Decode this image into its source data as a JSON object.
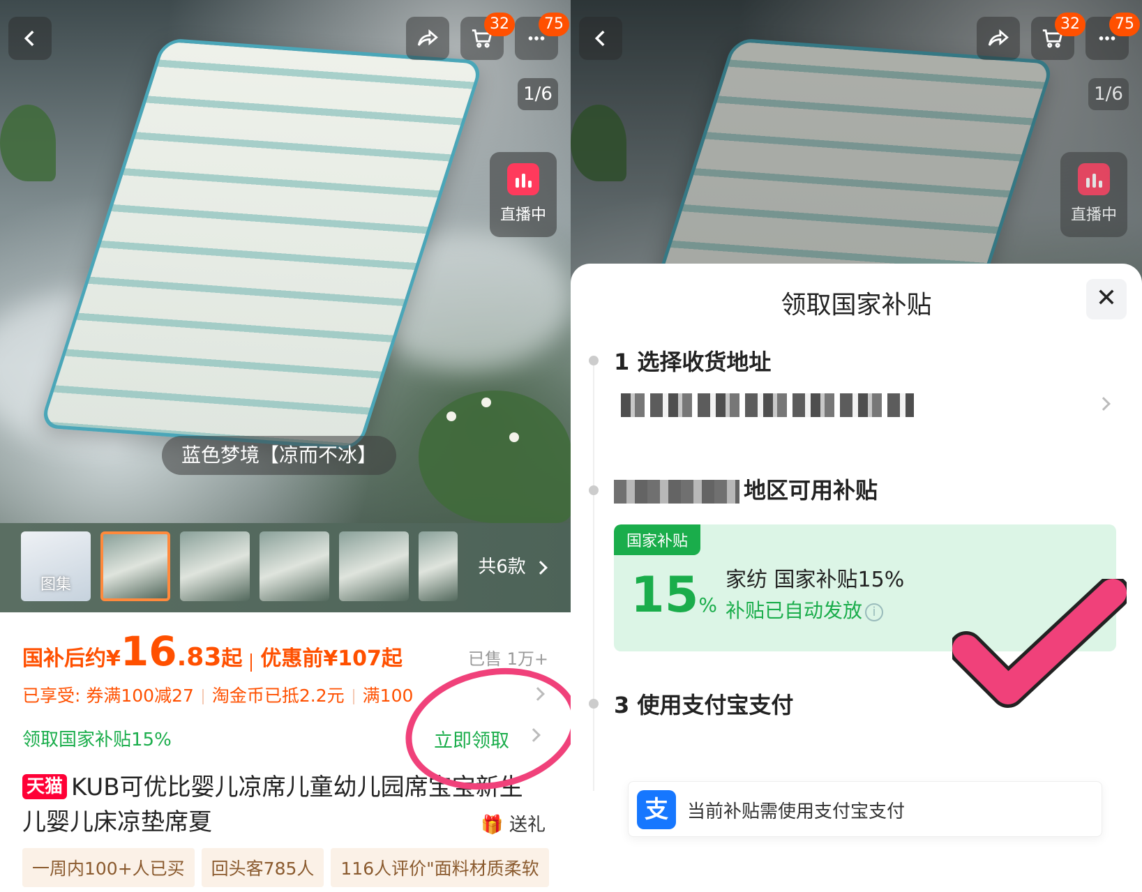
{
  "left": {
    "top_bar": {
      "cart_badge": "32",
      "more_badge": "75",
      "pager": "1/6",
      "live_label": "直播中"
    },
    "variant_label": "蓝色梦境【凉而不冰】",
    "thumbnails": {
      "first_label": "图集",
      "count_label": "共6款"
    },
    "price": {
      "prefix": "国补后约",
      "currency": "¥",
      "int": "16",
      "dec": ".83",
      "suffix": "起",
      "original": "优惠前¥107起",
      "sold": "已售 1万+"
    },
    "promos": [
      "已享受: 券满100减27",
      "淘金币已抵2.2元",
      "满100"
    ],
    "claim": {
      "text": "领取国家补贴15%",
      "button": "立即领取"
    },
    "product": {
      "badge": "天猫",
      "title": "KUB可优比婴儿凉席儿童幼儿园席宝宝新生儿婴儿床凉垫席夏",
      "gift": "送礼"
    },
    "tags": [
      "一周内100+人已买",
      "回头客785人",
      "116人评价\"面料材质柔软"
    ]
  },
  "right": {
    "top_bar": {
      "cart_badge": "32",
      "more_badge": "75",
      "pager": "1/6",
      "live_label": "直播中"
    },
    "sheet": {
      "title": "领取国家补贴",
      "close": "✕",
      "step1": "1 选择收货地址",
      "step2_visible": "地区可用补贴",
      "subsidy_tag": "国家补贴",
      "pct_value": "15",
      "pct_unit": "%",
      "subsidy_name": "家纺 国家补贴15%",
      "subsidy_status": "补贴已自动发放",
      "step3": "3 使用支付宝支付",
      "alipay_icon": "支",
      "pay_note": "当前补贴需使用支付宝支付"
    }
  },
  "colors": {
    "accent": "#ff5000",
    "green": "#1aad4b",
    "annotation": "#f0417a",
    "alipay": "#1677ff",
    "tmall": "#ff0036"
  }
}
